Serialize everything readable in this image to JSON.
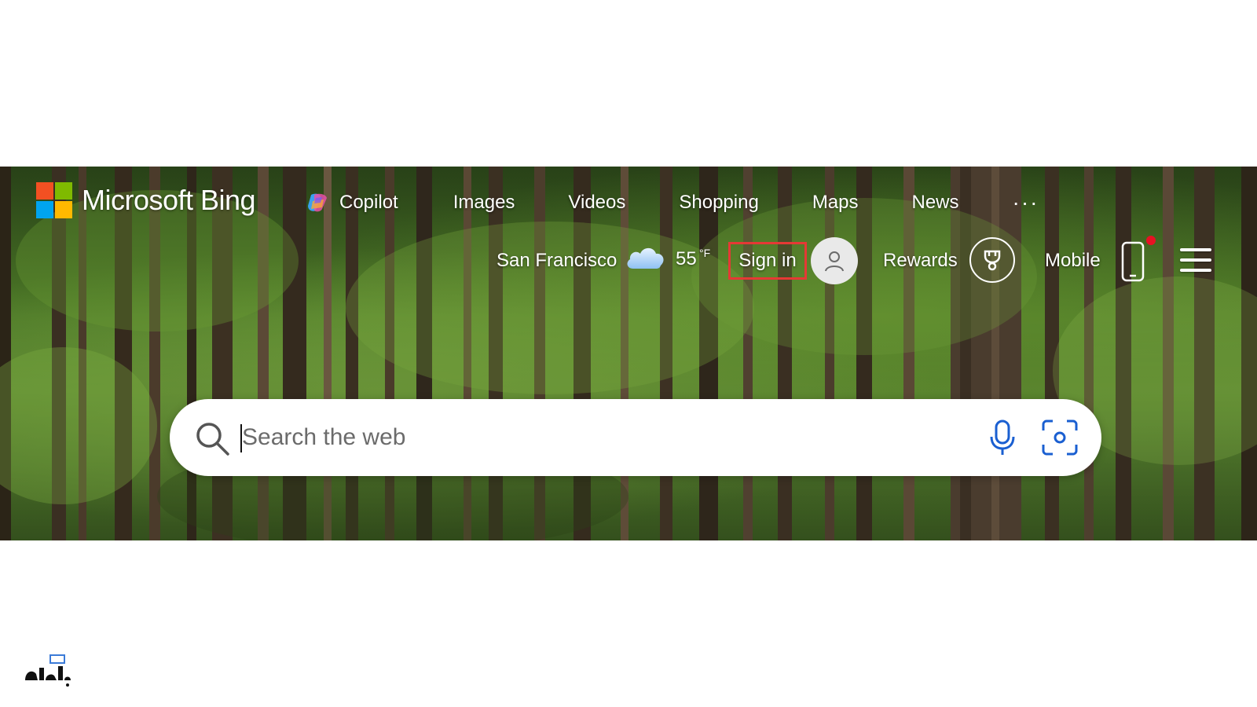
{
  "brand": {
    "name": "Microsoft Bing"
  },
  "nav": {
    "items": [
      {
        "label": "Copilot",
        "icon": "copilot-icon"
      },
      {
        "label": "Images"
      },
      {
        "label": "Videos"
      },
      {
        "label": "Shopping"
      },
      {
        "label": "Maps"
      },
      {
        "label": "News"
      }
    ],
    "more_label": "···"
  },
  "weather": {
    "city": "San Francisco",
    "temp": "55",
    "unit": "°F",
    "icon": "cloud-icon"
  },
  "account": {
    "signin_label": "Sign in",
    "avatar_icon": "person-icon"
  },
  "rewards": {
    "label": "Rewards",
    "icon": "trophy-icon"
  },
  "mobile": {
    "label": "Mobile",
    "icon": "phone-icon",
    "has_notification": true
  },
  "search": {
    "placeholder": "Search the web",
    "value": ""
  },
  "colors": {
    "highlight_border": "#e53935",
    "accent_blue": "#1a5fd1",
    "notification": "#e81123"
  }
}
